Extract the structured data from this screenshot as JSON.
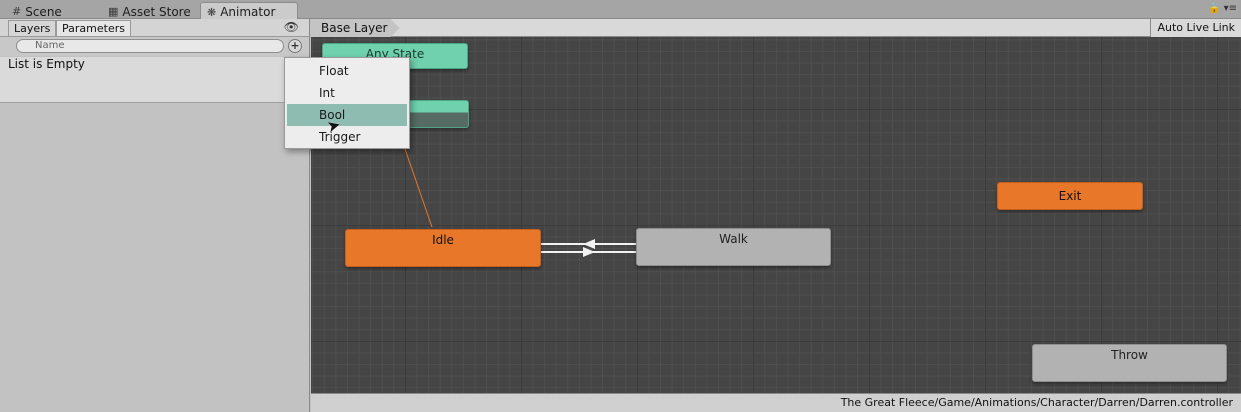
{
  "tabs": [
    {
      "label": "Scene",
      "icon": "grid-icon"
    },
    {
      "label": "Asset Store",
      "icon": "store-icon"
    },
    {
      "label": "Animator",
      "icon": "animator-icon"
    }
  ],
  "left_panel": {
    "tabs": [
      "Layers",
      "Parameters"
    ],
    "search_placeholder": "Name",
    "empty_text": "List is Empty"
  },
  "menu": {
    "items": [
      "Float",
      "Int",
      "Bool",
      "Trigger"
    ],
    "hovered": "Bool"
  },
  "graph": {
    "breadcrumb": "Base Layer",
    "auto_live_link": "Auto Live Link",
    "status_path": "The Great Fleece/Game/Animations/Character/Darren/Darren.controller",
    "nodes": {
      "any_state": "Any State",
      "idle": "Idle",
      "walk": "Walk",
      "exit": "Exit",
      "throw": "Throw"
    }
  },
  "colors": {
    "default_state": "#e9772a",
    "state": "#b2b2b2",
    "any_state": "#6fd1ad",
    "menu_hover": "#8fbcb0"
  }
}
